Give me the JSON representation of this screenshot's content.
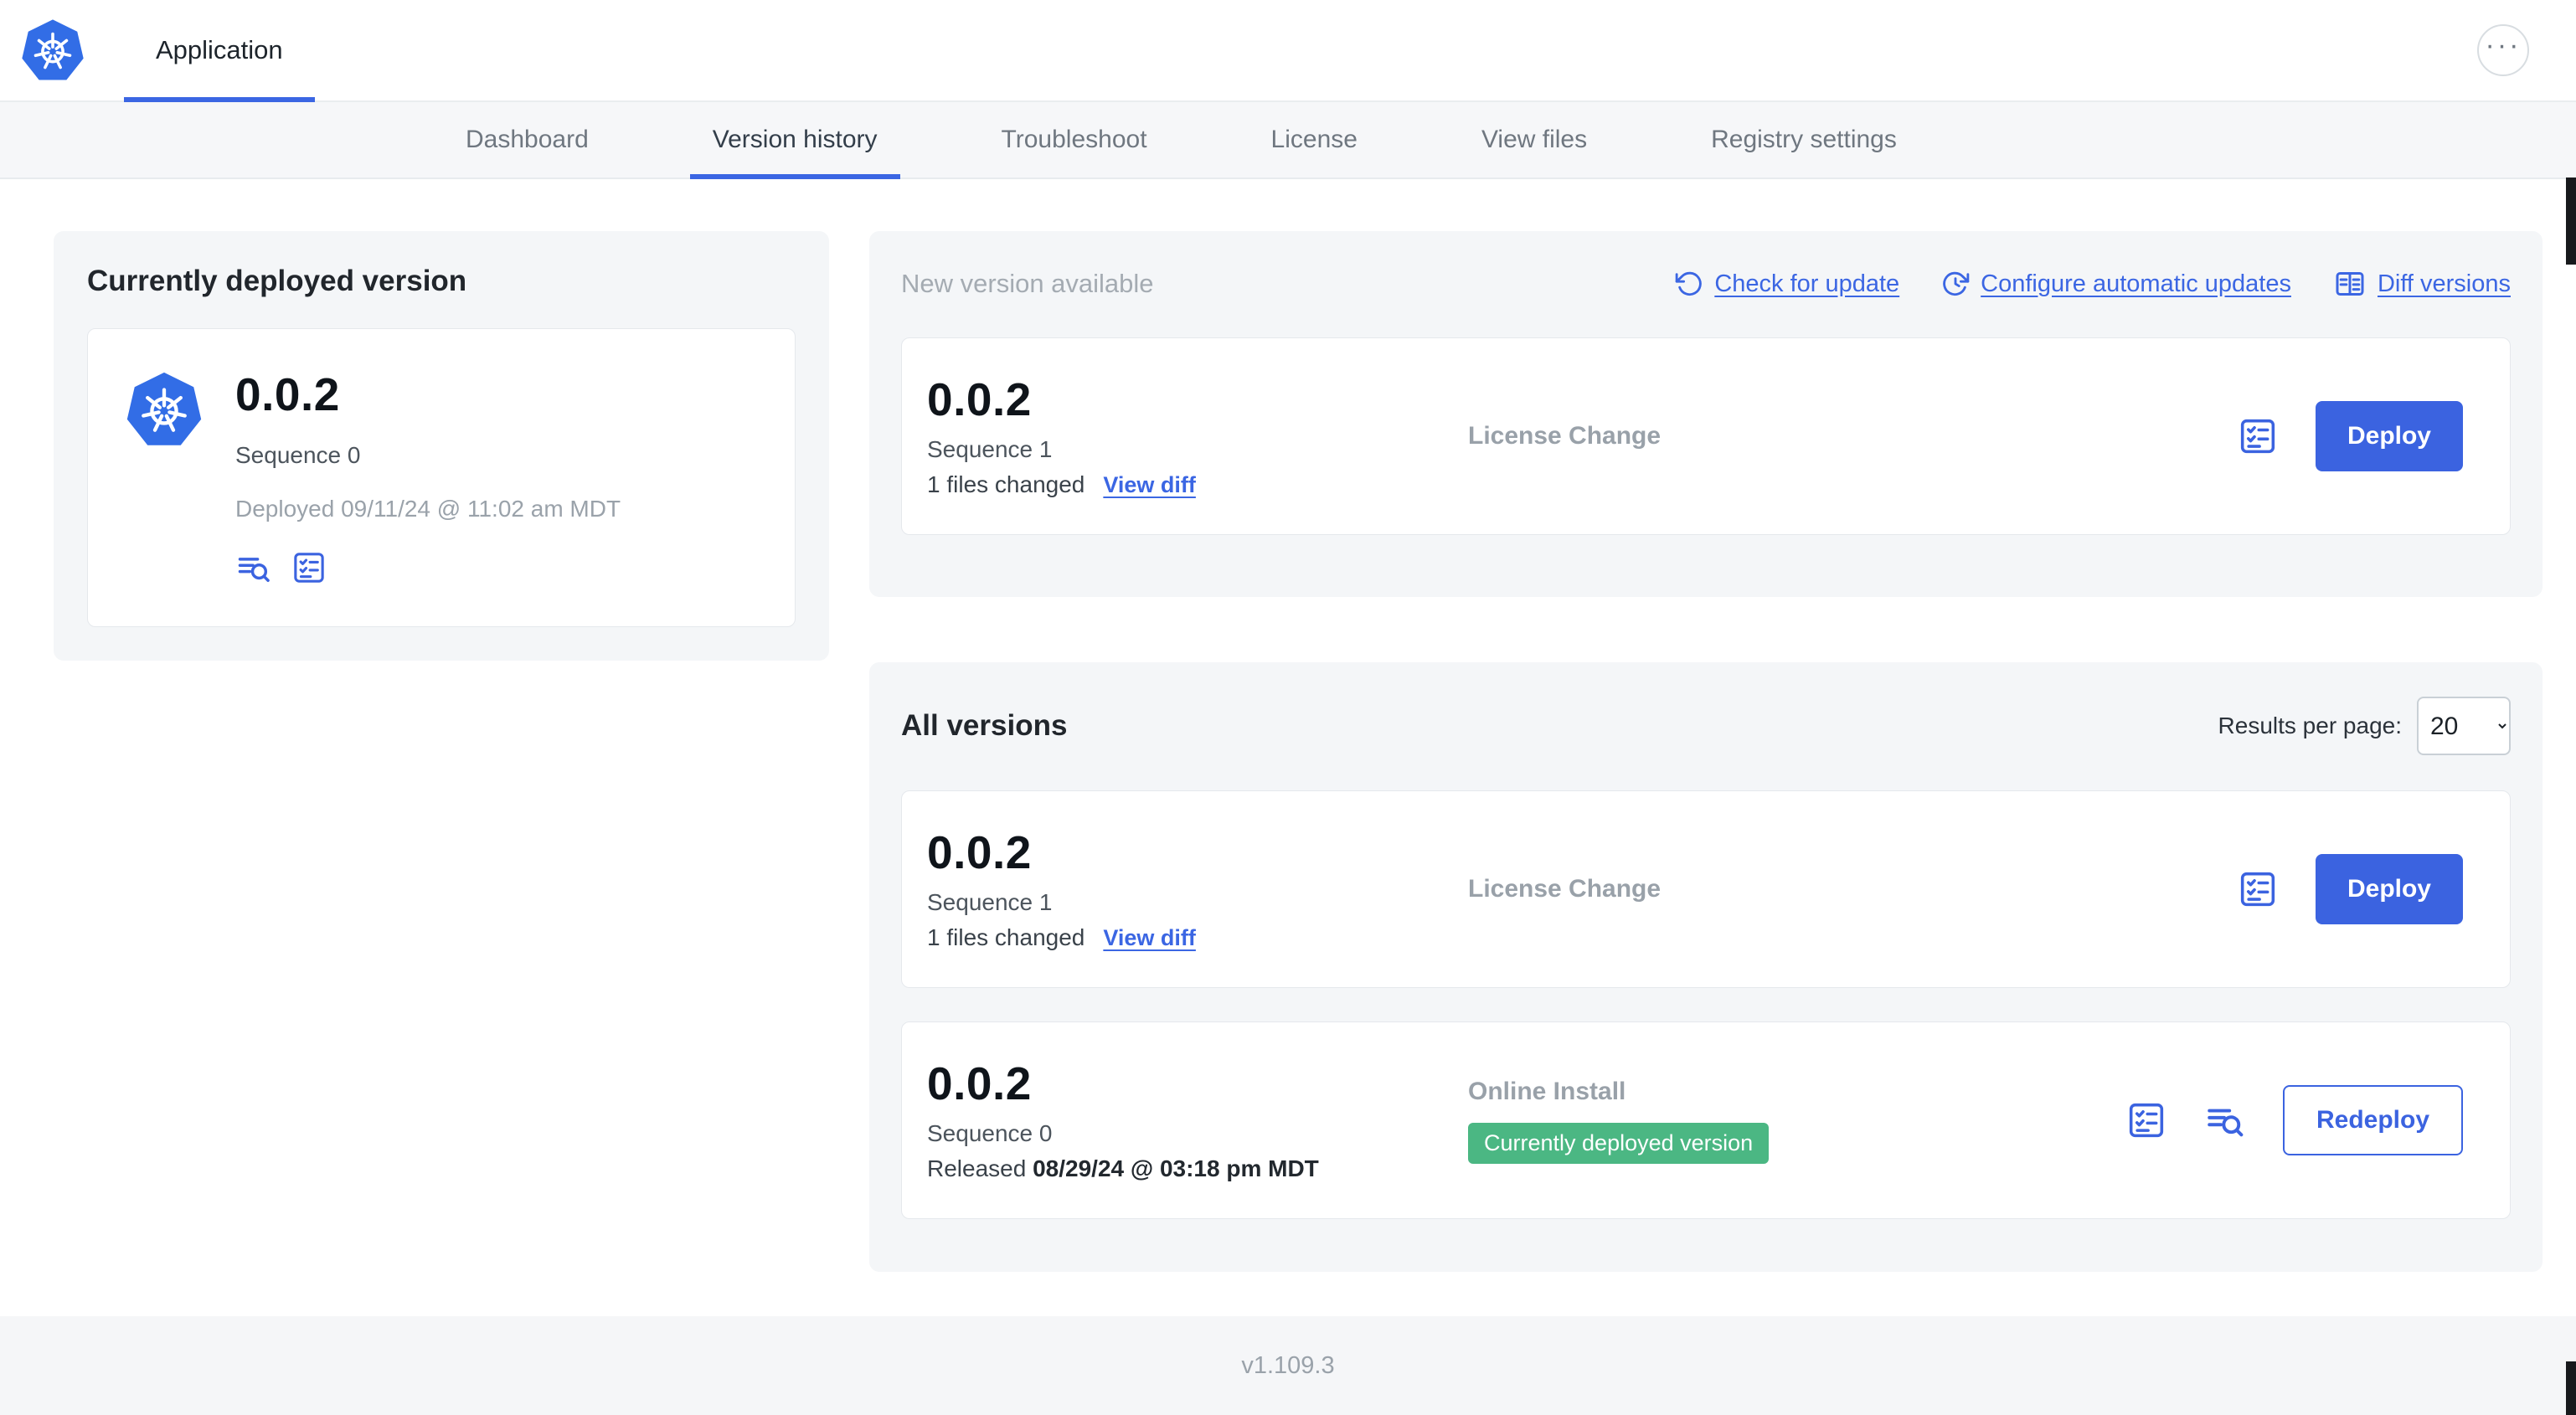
{
  "colors": {
    "accent_blue": "#3b63e0",
    "kubernetes_blue": "#326de6",
    "badge_green": "#4bb783",
    "panel_gray": "#f4f6f8"
  },
  "icons": {
    "more": "···",
    "app_logo": "kubernetes-wheel",
    "check_for_update": "circular-refresh-arrow",
    "configure_updates": "clock-with-refresh-arrow",
    "diff_versions": "split-table",
    "release_notes": "checklist-square",
    "view_logs": "lines-with-magnifier"
  },
  "header": {
    "application_tab": "Application",
    "more_icon": "···"
  },
  "nav": {
    "tabs": [
      {
        "label": "Dashboard",
        "active": false
      },
      {
        "label": "Version history",
        "active": true
      },
      {
        "label": "Troubleshoot",
        "active": false
      },
      {
        "label": "License",
        "active": false
      },
      {
        "label": "View files",
        "active": false
      },
      {
        "label": "Registry settings",
        "active": false
      }
    ]
  },
  "current_version": {
    "title": "Currently deployed version",
    "version": "0.0.2",
    "sequence": "Sequence 0",
    "deployed": "Deployed 09/11/24 @ 11:02 am MDT"
  },
  "new_version": {
    "title": "New version available",
    "actions": [
      {
        "label": "Check for update"
      },
      {
        "label": "Configure automatic updates"
      },
      {
        "label": "Diff versions"
      }
    ],
    "card": {
      "version": "0.0.2",
      "sequence": "Sequence 1",
      "files_changed": "1 files changed",
      "view_diff_label": "View diff",
      "source": "License Change",
      "deploy_label": "Deploy"
    }
  },
  "all_versions": {
    "title": "All versions",
    "results_per_page_label": "Results per page:",
    "results_per_page_value": "20",
    "rows": [
      {
        "version": "0.0.2",
        "sequence": "Sequence 1",
        "files_changed": "1 files changed",
        "view_diff_label": "View diff",
        "source": "License Change",
        "action_label": "Deploy"
      },
      {
        "version": "0.0.2",
        "sequence": "Sequence 0",
        "released_prefix": "Released ",
        "released_date": "08/29/24 @ 03:18 pm MDT",
        "source": "Online Install",
        "badge": "Currently deployed version",
        "action_label": "Redeploy"
      }
    ]
  },
  "footer": {
    "app_version": "v1.109.3"
  }
}
